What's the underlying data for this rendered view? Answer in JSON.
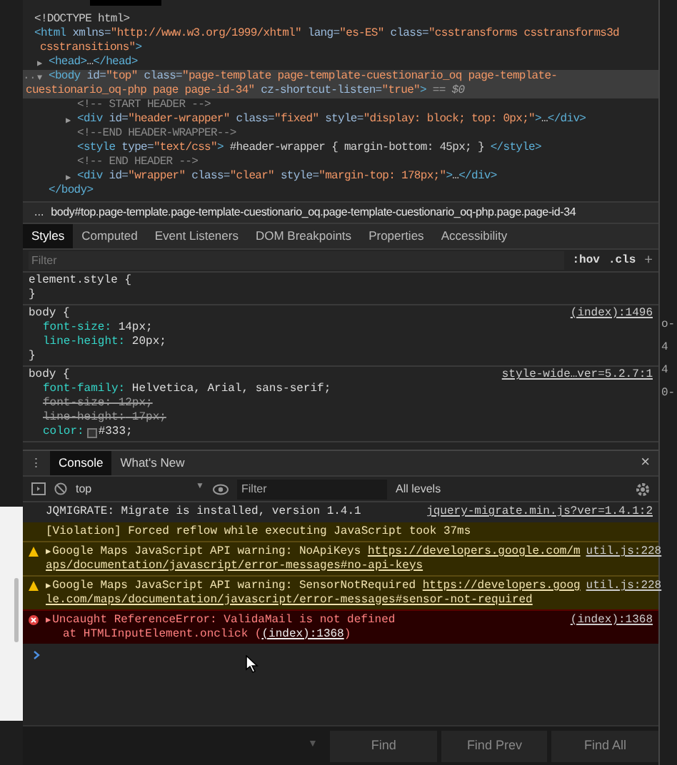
{
  "elements": {
    "nodes": [
      {
        "lines": [
          [
            {
              "kind": "doctype",
              "text": "<!DOCTYPE html>"
            }
          ]
        ]
      },
      {
        "lines": [
          [
            {
              "kind": "tag",
              "text": "<html"
            },
            {
              "kind": "attr",
              "text": " xmlns="
            },
            {
              "kind": "value",
              "text": "\"http://www.w3.org/1999/xhtml\""
            },
            {
              "kind": "attr",
              "text": " lang="
            },
            {
              "kind": "value",
              "text": "\"es-ES\""
            },
            {
              "kind": "attr",
              "text": " class="
            },
            {
              "kind": "value",
              "text": "\"csstransforms csstransforms3d"
            }
          ],
          [
            {
              "kind": "value",
              "text": "csstransitions\""
            },
            {
              "kind": "tag",
              "text": ">"
            }
          ]
        ],
        "children": [
          {
            "arrow": "▶",
            "lines": [
              [
                {
                  "kind": "tag",
                  "text": "<head>"
                },
                {
                  "kind": "text",
                  "text": "…"
                },
                {
                  "kind": "tag",
                  "text": "</head>"
                }
              ]
            ]
          },
          {
            "arrow": "▼",
            "lead": "...",
            "selected": true,
            "lines": [
              [
                {
                  "kind": "tag",
                  "text": "<body"
                },
                {
                  "kind": "attr",
                  "text": " id="
                },
                {
                  "kind": "value",
                  "text": "\"top\""
                },
                {
                  "kind": "attr",
                  "text": " class="
                },
                {
                  "kind": "value",
                  "text": "\"page-template page-template-cuestionario_oq page-template-"
                }
              ],
              [
                {
                  "kind": "value",
                  "text": "cuestionario_oq-php page page-id-34\""
                },
                {
                  "kind": "attr",
                  "text": " cz-shortcut-listen="
                },
                {
                  "kind": "value",
                  "text": "\"true\""
                },
                {
                  "kind": "tag",
                  "text": ">"
                },
                {
                  "kind": "ref",
                  "text": " == $0"
                }
              ]
            ],
            "closing": [
              {
                "kind": "tag",
                "text": "</body>"
              }
            ],
            "children": [
              {
                "lines": [
                  [
                    {
                      "kind": "comment",
                      "text": "<!-- START HEADER -->"
                    }
                  ]
                ]
              },
              {
                "arrow": "▶",
                "lines": [
                  [
                    {
                      "kind": "tag",
                      "text": "<div"
                    },
                    {
                      "kind": "attr",
                      "text": " id="
                    },
                    {
                      "kind": "value",
                      "text": "\"header-wrapper\""
                    },
                    {
                      "kind": "attr",
                      "text": " class="
                    },
                    {
                      "kind": "value",
                      "text": "\"fixed\""
                    },
                    {
                      "kind": "attr",
                      "text": " style="
                    },
                    {
                      "kind": "value",
                      "text": "\"display: block; top: 0px;\""
                    },
                    {
                      "kind": "tag",
                      "text": ">"
                    },
                    {
                      "kind": "text",
                      "text": "…"
                    },
                    {
                      "kind": "tag",
                      "text": "</div>"
                    }
                  ]
                ]
              },
              {
                "lines": [
                  [
                    {
                      "kind": "comment",
                      "text": "<!--END HEADER-WRAPPER-->"
                    }
                  ]
                ]
              },
              {
                "lines": [
                  [
                    {
                      "kind": "tag",
                      "text": "<style"
                    },
                    {
                      "kind": "attr",
                      "text": " type="
                    },
                    {
                      "kind": "value",
                      "text": "\"text/css\""
                    },
                    {
                      "kind": "tag",
                      "text": ">"
                    },
                    {
                      "kind": "text",
                      "text": " #header-wrapper { margin-bottom: 45px; } "
                    },
                    {
                      "kind": "tag",
                      "text": "</style>"
                    }
                  ]
                ]
              },
              {
                "lines": [
                  [
                    {
                      "kind": "comment",
                      "text": "<!-- END HEADER -->"
                    }
                  ]
                ]
              },
              {
                "arrow": "▶",
                "lines": [
                  [
                    {
                      "kind": "tag",
                      "text": "<div"
                    },
                    {
                      "kind": "attr",
                      "text": " id="
                    },
                    {
                      "kind": "value",
                      "text": "\"wrapper\""
                    },
                    {
                      "kind": "attr",
                      "text": " class="
                    },
                    {
                      "kind": "value",
                      "text": "\"clear\""
                    },
                    {
                      "kind": "attr",
                      "text": " style="
                    },
                    {
                      "kind": "value",
                      "text": "\"margin-top: 178px;\""
                    },
                    {
                      "kind": "tag",
                      "text": ">"
                    },
                    {
                      "kind": "text",
                      "text": "…"
                    },
                    {
                      "kind": "tag",
                      "text": "</div>"
                    }
                  ]
                ]
              }
            ]
          }
        ]
      }
    ]
  },
  "breadcrumb": {
    "ellipsis": "...",
    "path": "body#top.page-template.page-template-cuestionario_oq.page-template-cuestionario_oq-php.page.page-id-34"
  },
  "styles_tabs": [
    {
      "label": "Styles",
      "selected": true
    },
    {
      "label": "Computed",
      "selected": false
    },
    {
      "label": "Event Listeners",
      "selected": false
    },
    {
      "label": "DOM Breakpoints",
      "selected": false
    },
    {
      "label": "Properties",
      "selected": false
    },
    {
      "label": "Accessibility",
      "selected": false
    }
  ],
  "styles_filter": {
    "placeholder": "Filter",
    "hov": ":hov",
    "cls": ".cls",
    "add": "+"
  },
  "rules": [
    {
      "open": "element.style {",
      "close": "}"
    },
    {
      "open": "body {",
      "source": "(index):1496",
      "close": "}",
      "properties": [
        {
          "name": "font-size:",
          "value": " 14px;",
          "overridden": false
        },
        {
          "name": "line-height:",
          "value": " 20px;",
          "overridden": false
        }
      ]
    },
    {
      "open": "body {",
      "source": "style-wide…ver=5.2.7:1",
      "properties": [
        {
          "name": "font-family:",
          "value": " Helvetica, Arial, sans-serif;",
          "overridden": false
        },
        {
          "name": "font-size:",
          "value": " 12px;",
          "overridden": true
        },
        {
          "name": "line-height:",
          "value": " 17px;",
          "overridden": true
        },
        {
          "name": "color:",
          "value": "#333;",
          "overridden": false,
          "swatch": true
        }
      ]
    }
  ],
  "drawer": {
    "menu": "⋮",
    "tabs": [
      {
        "label": "Console",
        "selected": true
      },
      {
        "label": "What's New",
        "selected": false
      }
    ],
    "close": "×"
  },
  "console_toolbar": {
    "context": "top",
    "filter_placeholder": "Filter",
    "levels": "All levels"
  },
  "messages": [
    {
      "kind": "info",
      "text": "JQMIGRATE: Migrate is installed, version 1.4.1",
      "source": "jquery-migrate.min.js?ver=1.4.1:2"
    },
    {
      "kind": "violation",
      "text": "[Violation] Forced reflow while executing JavaScript took 37ms"
    },
    {
      "kind": "warning",
      "text": "Google Maps JavaScript API warning: NoApiKeys ",
      "link": "https://developers.google.com/m",
      "link2": "aps/documentation/javascript/error-messages#no-api-keys",
      "source": "util.js:228"
    },
    {
      "kind": "warning",
      "text": "Google Maps JavaScript API warning: SensorNotRequired ",
      "link": "https://developers.goog",
      "link2": "le.com/maps/documentation/javascript/error-messages#sensor-not-required",
      "source": "util.js:228"
    },
    {
      "kind": "error",
      "text": "Uncaught ReferenceError: ValidaMail is not defined",
      "detail": "at HTMLInputElement.onclick (",
      "detail_link": "(index):1368",
      "detail_end": ")",
      "source": "(index):1368"
    }
  ],
  "find_bar": {
    "buttons": [
      "Find",
      "Find Prev",
      "Find All"
    ]
  },
  "right_gutter": [
    "o-",
    "4",
    "4",
    "0-"
  ]
}
